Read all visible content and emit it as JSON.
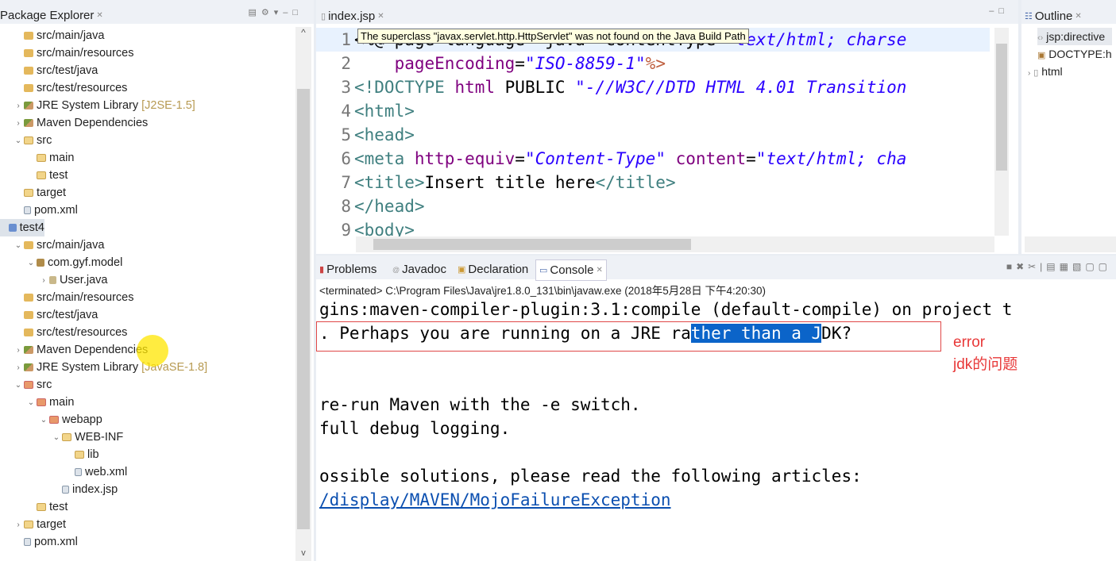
{
  "package_explorer": {
    "title": "Package Explorer",
    "items": [
      {
        "label": "src/main/java",
        "level": 1,
        "icon": "source-folder-icon",
        "expander": ""
      },
      {
        "label": "src/main/resources",
        "level": 1,
        "icon": "source-folder-icon",
        "expander": ""
      },
      {
        "label": "src/test/java",
        "level": 1,
        "icon": "source-folder-icon",
        "expander": ""
      },
      {
        "label": "src/test/resources",
        "level": 1,
        "icon": "source-folder-icon",
        "expander": ""
      },
      {
        "label": "JRE System Library",
        "decoration": "[J2SE-1.5]",
        "level": 1,
        "icon": "library-icon",
        "expander": ">"
      },
      {
        "label": "Maven Dependencies",
        "level": 1,
        "icon": "library-icon",
        "expander": ">"
      },
      {
        "label": "src",
        "level": 1,
        "icon": "folder-icon",
        "expander": "v"
      },
      {
        "label": "main",
        "level": 2,
        "icon": "folder-icon",
        "expander": ""
      },
      {
        "label": "test",
        "level": 2,
        "icon": "folder-icon",
        "expander": ""
      },
      {
        "label": "target",
        "level": 1,
        "icon": "folder-icon",
        "expander": ""
      },
      {
        "label": "pom.xml",
        "level": 1,
        "icon": "xml-file-icon",
        "expander": ""
      },
      {
        "label": "test4",
        "level": 0,
        "icon": "project-icon",
        "expander": "",
        "selected": true
      },
      {
        "label": "src/main/java",
        "level": 1,
        "icon": "source-folder-icon",
        "expander": "v"
      },
      {
        "label": "com.gyf.model",
        "level": 2,
        "icon": "package-icon",
        "expander": "v"
      },
      {
        "label": "User.java",
        "level": 3,
        "icon": "java-file-icon",
        "expander": ">"
      },
      {
        "label": "src/main/resources",
        "level": 1,
        "icon": "source-folder-icon",
        "expander": ""
      },
      {
        "label": "src/test/java",
        "level": 1,
        "icon": "source-folder-icon",
        "expander": ""
      },
      {
        "label": "src/test/resources",
        "level": 1,
        "icon": "source-folder-icon",
        "expander": ""
      },
      {
        "label": "Maven Dependencies",
        "level": 1,
        "icon": "library-icon",
        "expander": ">"
      },
      {
        "label": "JRE System Library",
        "decoration": "[JavaSE-1.8]",
        "level": 1,
        "icon": "library-icon",
        "expander": ">"
      },
      {
        "label": "src",
        "level": 1,
        "icon": "web-folder-icon",
        "expander": "v"
      },
      {
        "label": "main",
        "level": 2,
        "icon": "web-folder-icon",
        "expander": "v"
      },
      {
        "label": "webapp",
        "level": 3,
        "icon": "web-folder-icon",
        "expander": "v"
      },
      {
        "label": "WEB-INF",
        "level": 4,
        "icon": "folder-icon",
        "expander": "v"
      },
      {
        "label": "lib",
        "level": 5,
        "icon": "folder-icon",
        "expander": ""
      },
      {
        "label": "web.xml",
        "level": 5,
        "icon": "xml-file-icon",
        "expander": ""
      },
      {
        "label": "index.jsp",
        "level": 4,
        "icon": "jsp-file-icon",
        "expander": ""
      },
      {
        "label": "test",
        "level": 2,
        "icon": "folder-icon",
        "expander": ""
      },
      {
        "label": "target",
        "level": 1,
        "icon": "folder-icon",
        "expander": ">"
      },
      {
        "label": "pom.xml",
        "level": 1,
        "icon": "xml-file-icon",
        "expander": ""
      }
    ]
  },
  "editor": {
    "tab": "index.jsp",
    "tooltip": "The superclass \"javax.servlet.http.HttpServlet\" was not found on the Java Build Path",
    "lines": [
      {
        "n": "1",
        "parts": [
          [
            "p",
            "<%@ page language=\"java\" contentType=\""
          ],
          [
            "s",
            "text/html; charse"
          ]
        ]
      },
      {
        "n": "2",
        "parts": [
          [
            "p",
            "    "
          ],
          [
            "a",
            "pageEncoding"
          ],
          [
            "p",
            "="
          ],
          [
            "s",
            "\"ISO-8859-1\""
          ],
          [
            "k",
            "%>"
          ]
        ]
      },
      {
        "n": "3",
        "parts": [
          [
            "t",
            "<!DOCTYPE "
          ],
          [
            "a",
            "html "
          ],
          [
            "p",
            "PUBLIC "
          ],
          [
            "s",
            "\"-//W3C//DTD HTML 4.01 Transition"
          ]
        ]
      },
      {
        "n": "4",
        "parts": [
          [
            "t",
            "<html>"
          ]
        ]
      },
      {
        "n": "5",
        "parts": [
          [
            "t",
            "<head>"
          ]
        ]
      },
      {
        "n": "6",
        "parts": [
          [
            "t",
            "<meta "
          ],
          [
            "a",
            "http-equiv"
          ],
          [
            "p",
            "="
          ],
          [
            "s",
            "\"Content-Type\""
          ],
          [
            "p",
            " "
          ],
          [
            "a",
            "content"
          ],
          [
            "p",
            "="
          ],
          [
            "s",
            "\"text/html; cha"
          ]
        ]
      },
      {
        "n": "7",
        "parts": [
          [
            "t",
            "<title>"
          ],
          [
            "p",
            "Insert title here"
          ],
          [
            "t",
            "</title>"
          ]
        ]
      },
      {
        "n": "8",
        "parts": [
          [
            "t",
            "</head>"
          ]
        ]
      },
      {
        "n": "9",
        "parts": [
          [
            "t",
            "<body>"
          ]
        ]
      }
    ]
  },
  "outline": {
    "title": "Outline",
    "items": [
      "jsp:directive",
      "DOCTYPE:h",
      "html"
    ]
  },
  "console": {
    "tabs": [
      "Problems",
      "Javadoc",
      "Declaration",
      "Console"
    ],
    "active_tab": "Console",
    "terminated": "<terminated> C:\\Program Files\\Java\\jre1.8.0_131\\bin\\javaw.exe (2018年5月28日 下午4:20:30)",
    "line1": "gins:maven-compiler-plugin:3.1:compile (default-compile) on project t",
    "line2_pre": ". Perhaps you are running on a JRE ra",
    "line2_sel": "ther than a J",
    "line2_post": "DK?",
    "line3": "",
    "line4": "",
    "line5": "re-run Maven with the -e switch.",
    "line6": "full debug logging.",
    "line7": "",
    "line8": "ossible solutions, please read the following articles:",
    "link": "/display/MAVEN/MojoFailureException"
  },
  "annotation": {
    "line1": "error",
    "line2": "jdk的问题",
    "color": "#e83838"
  }
}
